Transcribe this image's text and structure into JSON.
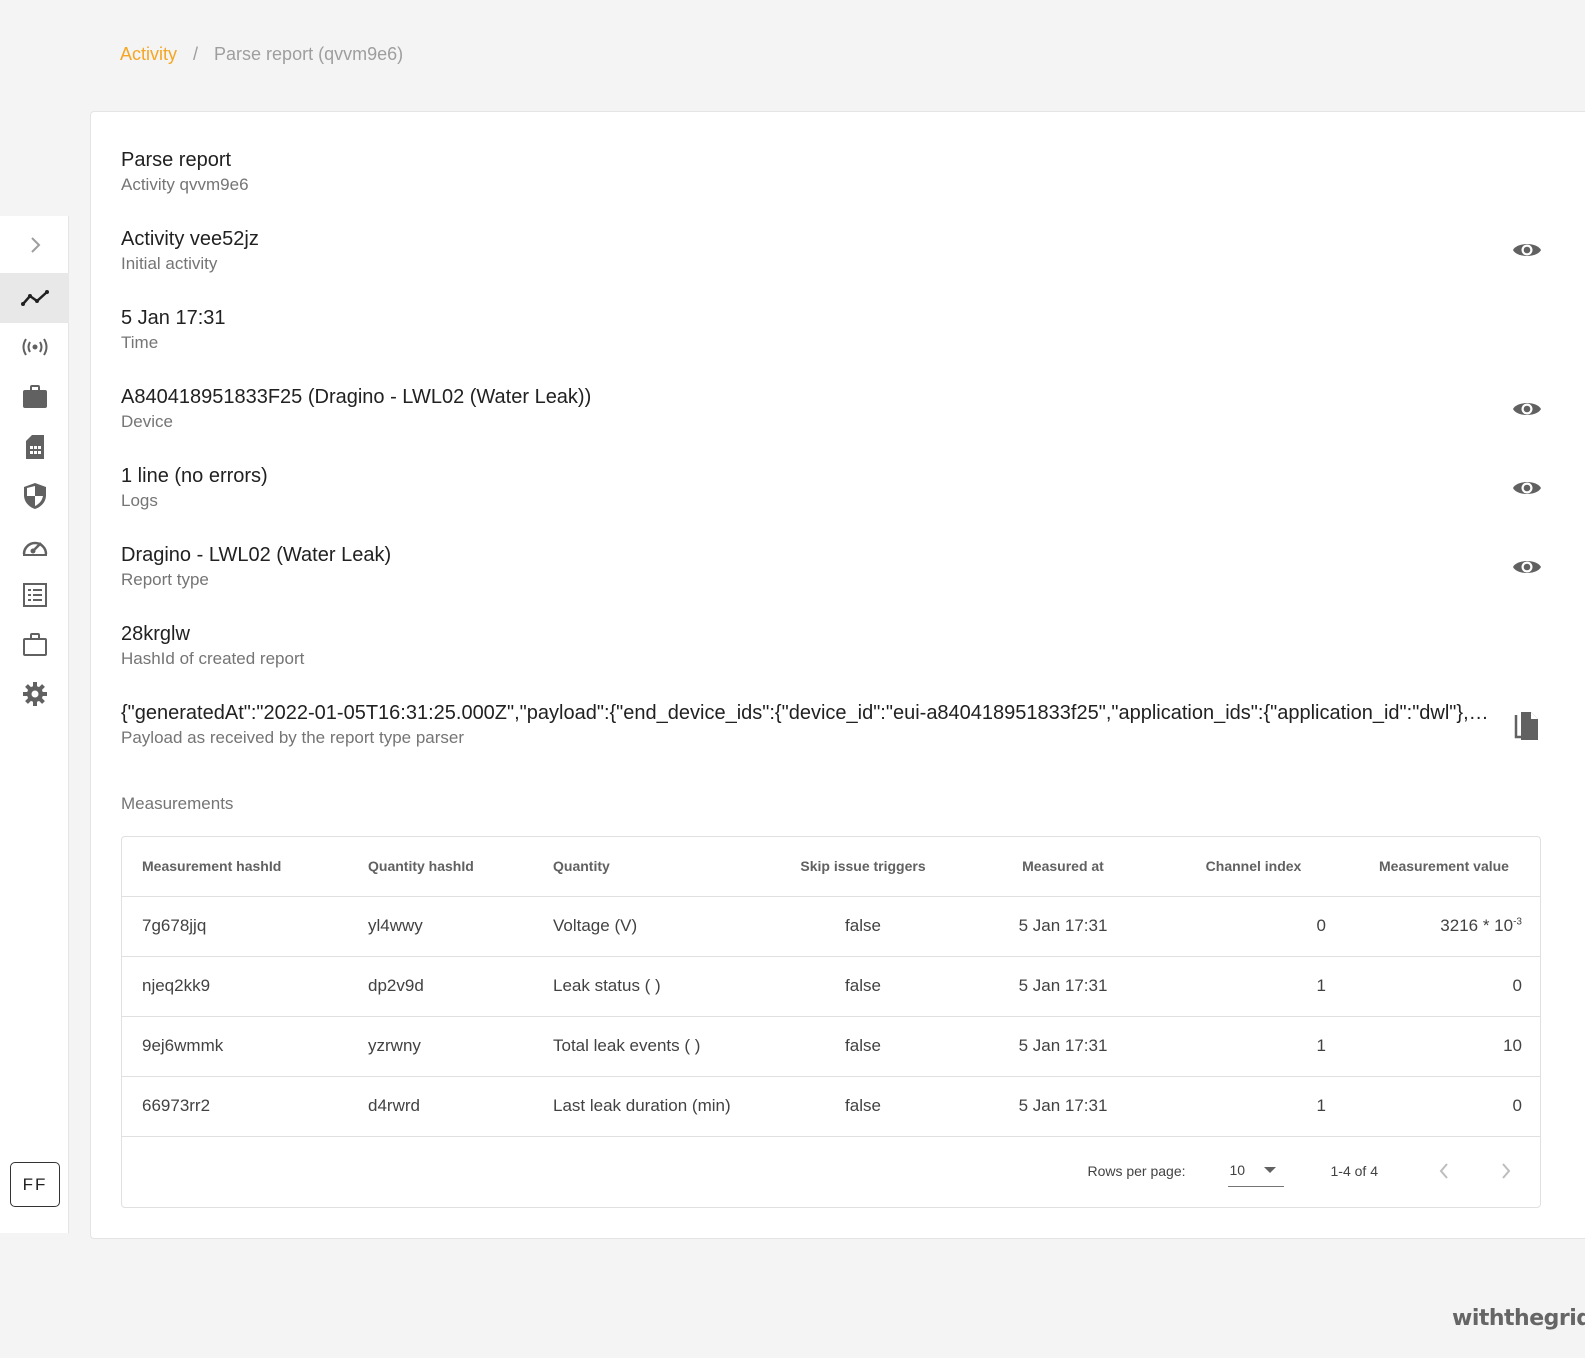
{
  "breadcrumb": {
    "parent": "Activity",
    "separator": "/",
    "current": "Parse report (qvvm9e6)"
  },
  "colors": {
    "accent": "#f5a623",
    "icon": "#616161"
  },
  "sidebar": {
    "items": [
      {
        "name": "expand",
        "icon": "chevron-right-icon"
      },
      {
        "name": "activity",
        "icon": "activity-line-icon",
        "active": true
      },
      {
        "name": "devices",
        "icon": "broadcast-icon"
      },
      {
        "name": "projects",
        "icon": "briefcase-filled-icon"
      },
      {
        "name": "sim",
        "icon": "sim-card-icon"
      },
      {
        "name": "security",
        "icon": "shield-icon"
      },
      {
        "name": "dashboard",
        "icon": "speedometer-icon"
      },
      {
        "name": "reports",
        "icon": "list-icon"
      },
      {
        "name": "organizations",
        "icon": "briefcase-outline-icon"
      },
      {
        "name": "settings",
        "icon": "gear-icon"
      }
    ],
    "avatar_initials": "FF"
  },
  "details": {
    "title": {
      "primary": "Parse report",
      "secondary": "Activity qvvm9e6"
    },
    "fields": [
      {
        "primary": "Activity vee52jz",
        "secondary": "Initial activity",
        "action": "view"
      },
      {
        "primary": "5 Jan 17:31",
        "secondary": "Time"
      },
      {
        "primary": "A840418951833F25 (Dragino - LWL02 (Water Leak))",
        "secondary": "Device",
        "action": "view"
      },
      {
        "primary": "1 line (no errors)",
        "secondary": "Logs",
        "action": "view"
      },
      {
        "primary": "Dragino - LWL02 (Water Leak)",
        "secondary": "Report type",
        "action": "view"
      },
      {
        "primary": "28krglw",
        "secondary": "HashId of created report"
      },
      {
        "primary": "{\"generatedAt\":\"2022-01-05T16:31:25.000Z\",\"payload\":{\"end_device_ids\":{\"device_id\":\"eui-a840418951833f25\",\"application_ids\":{\"application_id\":\"dwl\"},\"dev_e...",
        "secondary": "Payload as received by the report type parser",
        "action": "copy"
      }
    ]
  },
  "measurements": {
    "label": "Measurements",
    "columns": [
      "Measurement hashId",
      "Quantity hashId",
      "Quantity",
      "Skip issue triggers",
      "Measured at",
      "Channel index",
      "Measurement value"
    ],
    "rows": [
      {
        "measurement_hashid": "7g678jjq",
        "quantity_hashid": "yl4wwy",
        "quantity": "Voltage (V)",
        "skip": "false",
        "measured_at": "5 Jan 17:31",
        "channel": "0",
        "value": "3216 * 10",
        "exp": "-3"
      },
      {
        "measurement_hashid": "njeq2kk9",
        "quantity_hashid": "dp2v9d",
        "quantity": "Leak status ( )",
        "skip": "false",
        "measured_at": "5 Jan 17:31",
        "channel": "1",
        "value": "0",
        "exp": ""
      },
      {
        "measurement_hashid": "9ej6wmmk",
        "quantity_hashid": "yzrwny",
        "quantity": "Total leak events ( )",
        "skip": "false",
        "measured_at": "5 Jan 17:31",
        "channel": "1",
        "value": "10",
        "exp": ""
      },
      {
        "measurement_hashid": "66973rr2",
        "quantity_hashid": "d4rwrd",
        "quantity": "Last leak duration (min)",
        "skip": "false",
        "measured_at": "5 Jan 17:31",
        "channel": "1",
        "value": "0",
        "exp": ""
      }
    ],
    "pagination": {
      "rows_per_page_label": "Rows per page:",
      "rows_per_page": "10",
      "range": "1-4 of 4"
    }
  },
  "brand": "withthegrid"
}
